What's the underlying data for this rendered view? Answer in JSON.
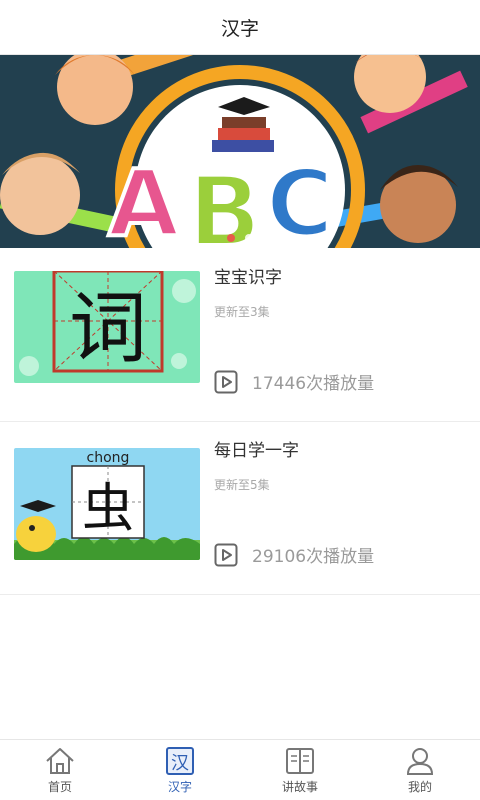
{
  "header": {
    "title": "汉字"
  },
  "banner": {
    "text": "ABC",
    "slides": 2,
    "active_slide": 1
  },
  "items": [
    {
      "title": "宝宝识字",
      "subtitle": "更新至3集",
      "plays": "17446次播放量",
      "thumb_char": "词"
    },
    {
      "title": "每日学一字",
      "subtitle": "更新至5集",
      "plays": "29106次播放量",
      "thumb_char": "虫",
      "thumb_pinyin": "chong"
    }
  ],
  "tabbar": {
    "active": "汉字",
    "tabs": [
      {
        "label": "首页",
        "icon": "home-icon"
      },
      {
        "label": "汉字",
        "icon": "hanzi-icon"
      },
      {
        "label": "讲故事",
        "icon": "book-icon"
      },
      {
        "label": "我的",
        "icon": "user-icon"
      }
    ]
  },
  "colors": {
    "accent": "#2f5fb3",
    "banner_bg": "#1f3b4a"
  }
}
